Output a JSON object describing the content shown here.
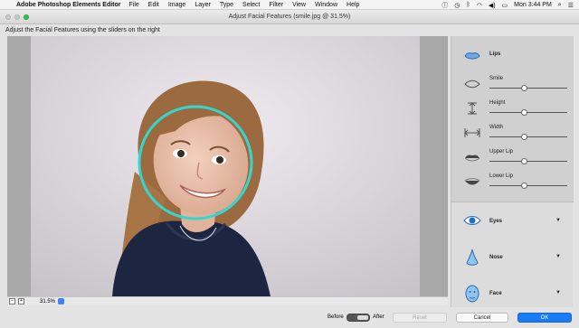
{
  "menubar": {
    "app_name": "Adobe Photoshop Elements Editor",
    "items": [
      "File",
      "Edit",
      "Image",
      "Layer",
      "Type",
      "Select",
      "Filter",
      "View",
      "Window",
      "Help"
    ],
    "clock": "Mon 3:44 PM"
  },
  "window": {
    "title": "Adjust Facial Features (smile.jpg @ 31.5%)"
  },
  "instruction": "Adjust the Facial Features using the sliders on the right",
  "zoom": "31.5%",
  "panel": {
    "lips_header": "Lips",
    "sliders": [
      {
        "label": "Smile",
        "icon": "smile-icon",
        "value": 0.45
      },
      {
        "label": "Height",
        "icon": "height-icon",
        "value": 0.45
      },
      {
        "label": "Width",
        "icon": "width-icon",
        "value": 0.45
      },
      {
        "label": "Upper Lip",
        "icon": "upper-lip-icon",
        "value": 0.45
      },
      {
        "label": "Lower Lip",
        "icon": "lower-lip-icon",
        "value": 0.45
      }
    ],
    "groups": [
      {
        "label": "Eyes",
        "icon": "eye-icon"
      },
      {
        "label": "Nose",
        "icon": "nose-icon"
      },
      {
        "label": "Face",
        "icon": "face-icon"
      }
    ]
  },
  "footer": {
    "before": "Before",
    "after": "After",
    "reset": "Reset",
    "cancel": "Cancel",
    "ok": "OK"
  },
  "colors": {
    "accent": "#1a7cf5",
    "face_circle": "#35d6d0"
  }
}
